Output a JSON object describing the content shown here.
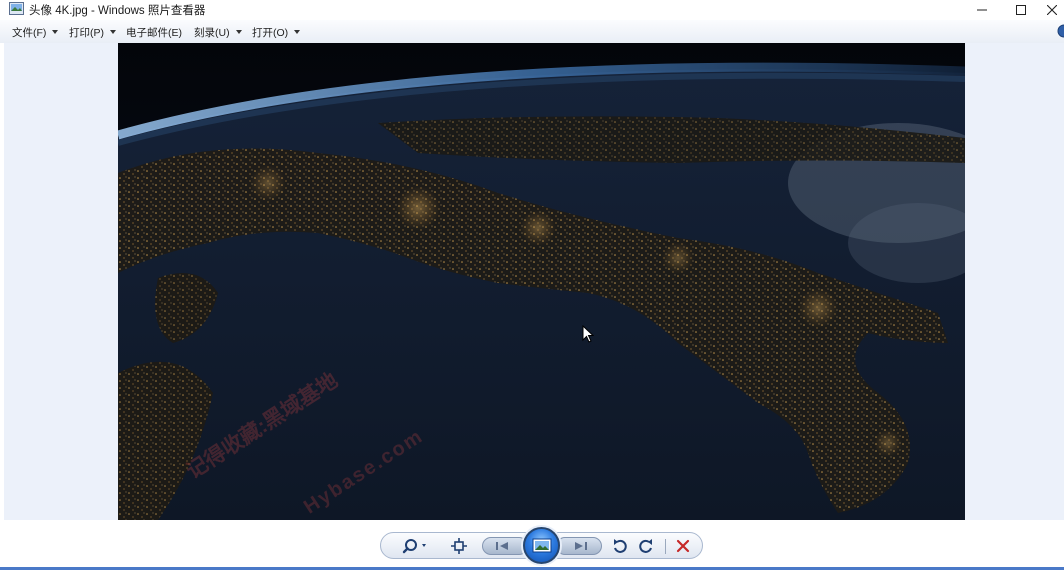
{
  "window": {
    "title": "头像 4K.jpg - Windows 照片查看器",
    "icon": "photo-viewer-icon",
    "controls": [
      "minimize-icon",
      "maximize-icon",
      "close-icon"
    ]
  },
  "menu": {
    "items": [
      {
        "label": "文件(F)",
        "has_dropdown": true
      },
      {
        "label": "打印(P)",
        "has_dropdown": true
      },
      {
        "label": "电子邮件(E)",
        "has_dropdown": false
      },
      {
        "label": "刻录(U)",
        "has_dropdown": true
      },
      {
        "label": "打开(O)",
        "has_dropdown": true
      }
    ],
    "help_icon": "help-icon"
  },
  "photo": {
    "description_icon": "earth-at-night-photo"
  },
  "watermark": {
    "line1": "记得收藏:黑域基地",
    "line2": "Hybase.com"
  },
  "toolbar": {
    "buttons": [
      "zoom-icon",
      "actual-size-icon",
      "previous-icon",
      "slideshow-icon",
      "next-icon",
      "rotate-left-icon",
      "rotate-right-icon",
      "delete-icon"
    ]
  },
  "colors": {
    "viewer_background": "#ecf1fa",
    "accent": "#2d7be0",
    "delete": "#c62828"
  }
}
